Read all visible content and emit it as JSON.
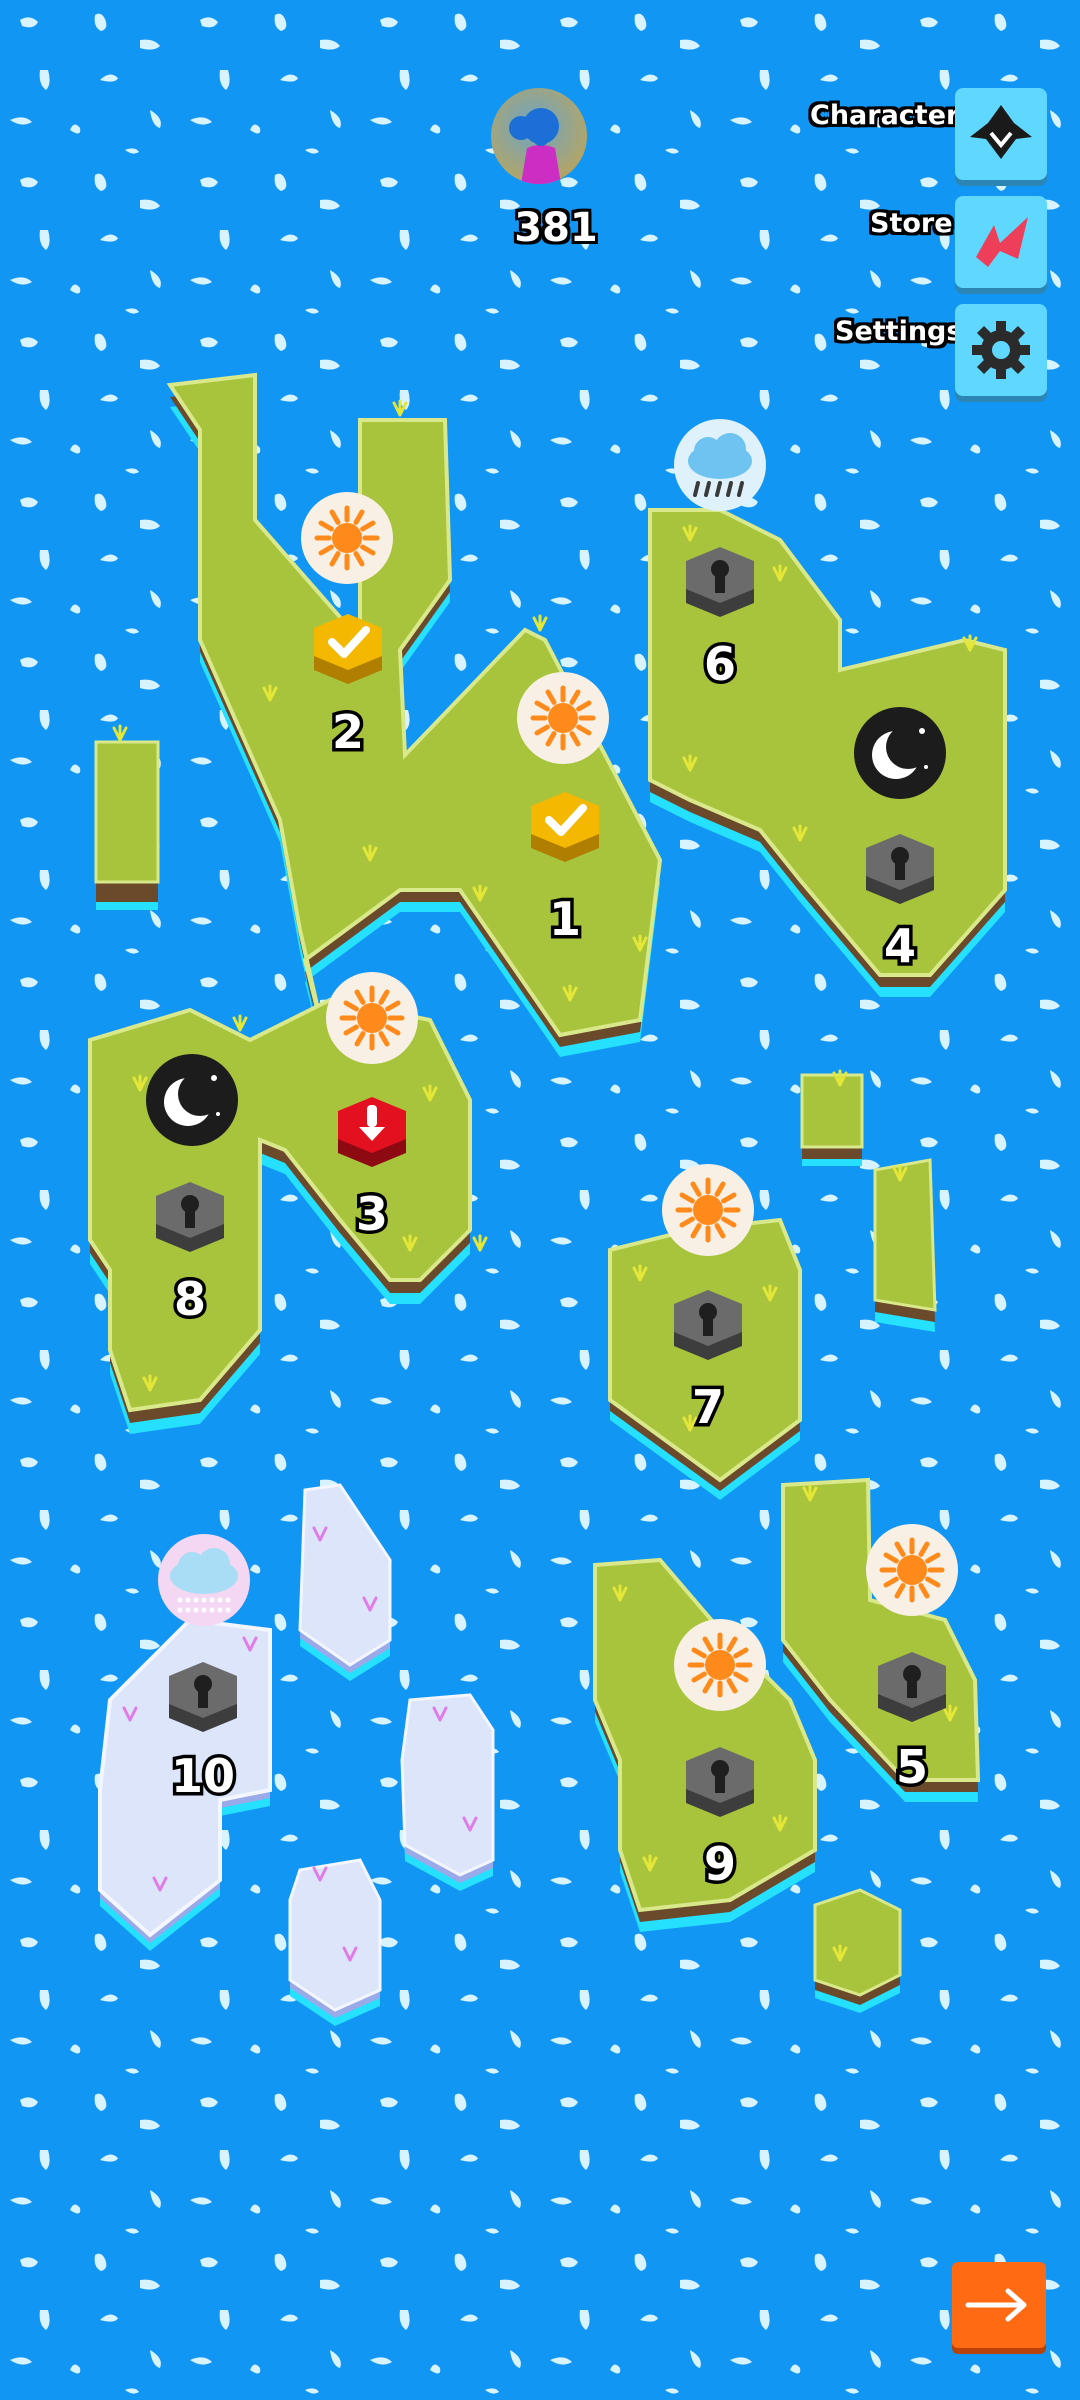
{
  "player": {
    "coins": "381"
  },
  "menu": {
    "character_label": "Character",
    "store_label": "Store",
    "settings_label": "Settings"
  },
  "levels": [
    {
      "number": "1",
      "weather": "sun-icon",
      "status": "completed"
    },
    {
      "number": "2",
      "weather": "sun-icon",
      "status": "completed"
    },
    {
      "number": "3",
      "weather": "sun-icon",
      "status": "current"
    },
    {
      "number": "4",
      "weather": "moon-icon",
      "status": "locked"
    },
    {
      "number": "5",
      "weather": "sun-icon",
      "status": "locked"
    },
    {
      "number": "6",
      "weather": "rain-cloud-icon",
      "status": "locked"
    },
    {
      "number": "7",
      "weather": "sun-icon",
      "status": "locked"
    },
    {
      "number": "8",
      "weather": "moon-icon",
      "status": "locked"
    },
    {
      "number": "9",
      "weather": "sun-icon",
      "status": "locked"
    },
    {
      "number": "10",
      "weather": "snow-cloud-icon",
      "status": "locked"
    }
  ],
  "colors": {
    "water": "#1196f3",
    "grass": "#a8c43c",
    "ice": "#dde5fb",
    "completed": "#f5b800",
    "current": "#e3101f",
    "locked": "#6b6b6b",
    "next_button": "#ff6a13"
  }
}
